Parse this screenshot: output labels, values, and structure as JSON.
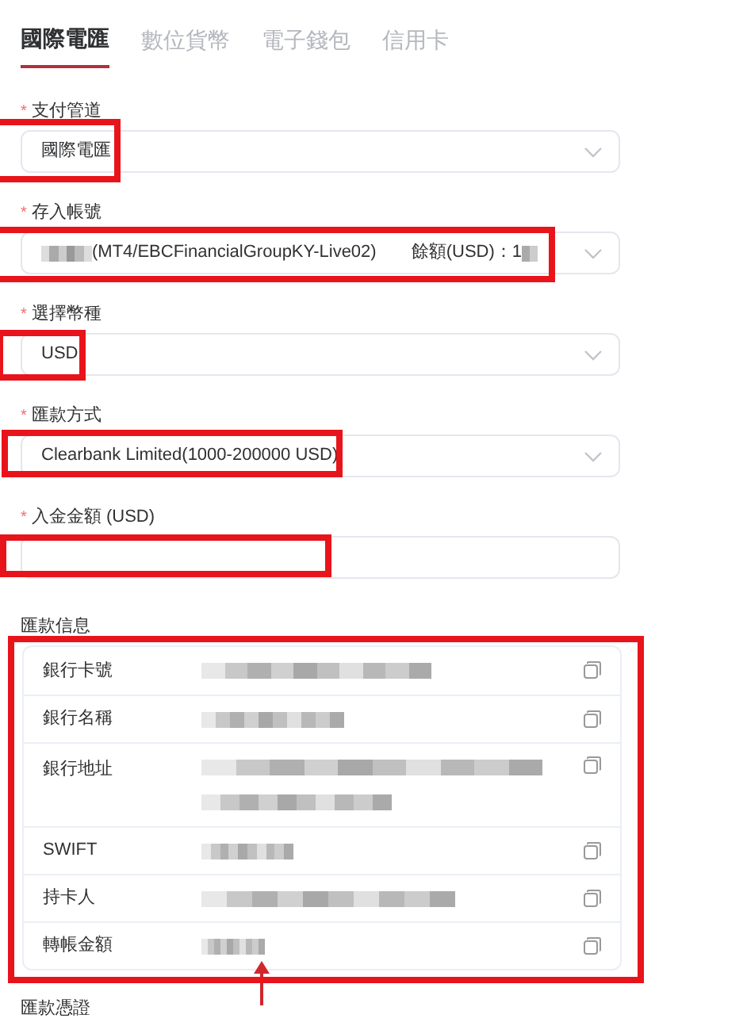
{
  "tabs": [
    {
      "label": "國際電匯",
      "selected": true
    },
    {
      "label": "數位貨幣",
      "selected": false
    },
    {
      "label": "電子錢包",
      "selected": false
    },
    {
      "label": "信用卡",
      "selected": false
    }
  ],
  "fields": [
    {
      "label": "支付管道",
      "required_mark": "*",
      "kind": "select",
      "value": "國際電匯",
      "highlighted": true
    },
    {
      "label": "存入帳號",
      "required_mark": "*",
      "kind": "account",
      "value": "(MT4/EBCFinancialGroupKY-Live02)",
      "balance": "餘額(USD)：1",
      "highlighted": true
    },
    {
      "label": "選擇幣種",
      "required_mark": "*",
      "kind": "select",
      "value": "USD",
      "highlighted": true
    },
    {
      "label": "匯款方式",
      "required_mark": "*",
      "kind": "select",
      "value": "Clearbank Limited(1000-200000 USD)",
      "highlighted": true
    },
    {
      "label": "入金金額 (USD)",
      "required_mark": "*",
      "kind": "input",
      "highlighted": true
    }
  ],
  "remittance_info": {
    "title": "匯款信息",
    "highlighted": true,
    "rows": [
      {
        "label": "銀行卡號",
        "redacted": true,
        "multiline": false,
        "pointed": false
      },
      {
        "label": "銀行名稱",
        "redacted": true,
        "multiline": false,
        "pointed": false
      },
      {
        "label": "銀行地址",
        "redacted": true,
        "multiline": true,
        "pointed": false
      },
      {
        "label": "SWIFT",
        "redacted": true,
        "multiline": false,
        "pointed": false
      },
      {
        "label": "持卡人",
        "redacted": true,
        "multiline": false,
        "pointed": false
      },
      {
        "label": "轉帳金額",
        "redacted": true,
        "multiline": false,
        "pointed": true
      }
    ]
  },
  "proof_section": {
    "title": "匯款憑證"
  }
}
